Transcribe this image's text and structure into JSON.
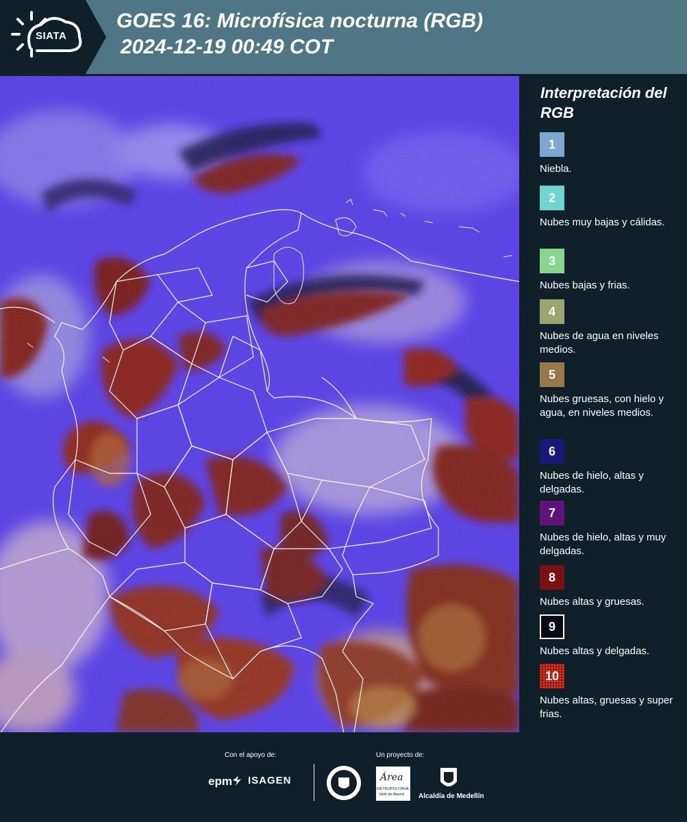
{
  "header": {
    "logo_text": "SIATA",
    "title_line1": "GOES 16: Microfísica nocturna (RGB)",
    "title_line2": "2024-12-19 00:49 COT",
    "logo_icon": "sun-cloud-icon"
  },
  "legend": {
    "title": "Interpretación del RGB",
    "items": [
      {
        "number": "1",
        "label": "Niebla.",
        "color": "#7ea6cf"
      },
      {
        "number": "2",
        "label": "Nubes muy bajas y cálidas.",
        "color": "#6fd6cf"
      },
      {
        "number": "3",
        "label": "Nubes bajas y frias.",
        "color": "#86d68f"
      },
      {
        "number": "4",
        "label": "Nubes de agua en niveles medios.",
        "color": "#9aa66d"
      },
      {
        "number": "5",
        "label": "Nubes gruesas, con hielo y agua, en niveles medios.",
        "color": "#97794b"
      },
      {
        "number": "6",
        "label": "Nubes de hielo, altas y delgadas.",
        "color": "#19177a"
      },
      {
        "number": "7",
        "label": "Nubes de hielo, altas y muy delgadas.",
        "color": "#5f147a"
      },
      {
        "number": "8",
        "label": "Nubes altas y gruesas.",
        "color": "#7a1010"
      },
      {
        "number": "9",
        "label": "Nubes altas y delgadas.",
        "color": "#0a0a12"
      },
      {
        "number": "10",
        "label": "Nubes altas, gruesas y super frias.",
        "color": "#a8190f"
      }
    ]
  },
  "footer": {
    "support_caption": "Con el apoyo de:",
    "project_caption": "Un proyecto de:",
    "epm": "epm",
    "isagen": "ISAGEN",
    "metropolitana": "METROPOLITANA",
    "area_valle": "Valle de Aburrá",
    "area_script": "Área",
    "alcaldia": "Alcaldía de Medellín"
  },
  "map": {
    "base_color": "#5a3df0",
    "cloud_red": "#7a1a1a",
    "cloud_light": "#b4a6e6",
    "border_color": "#ffffff"
  }
}
